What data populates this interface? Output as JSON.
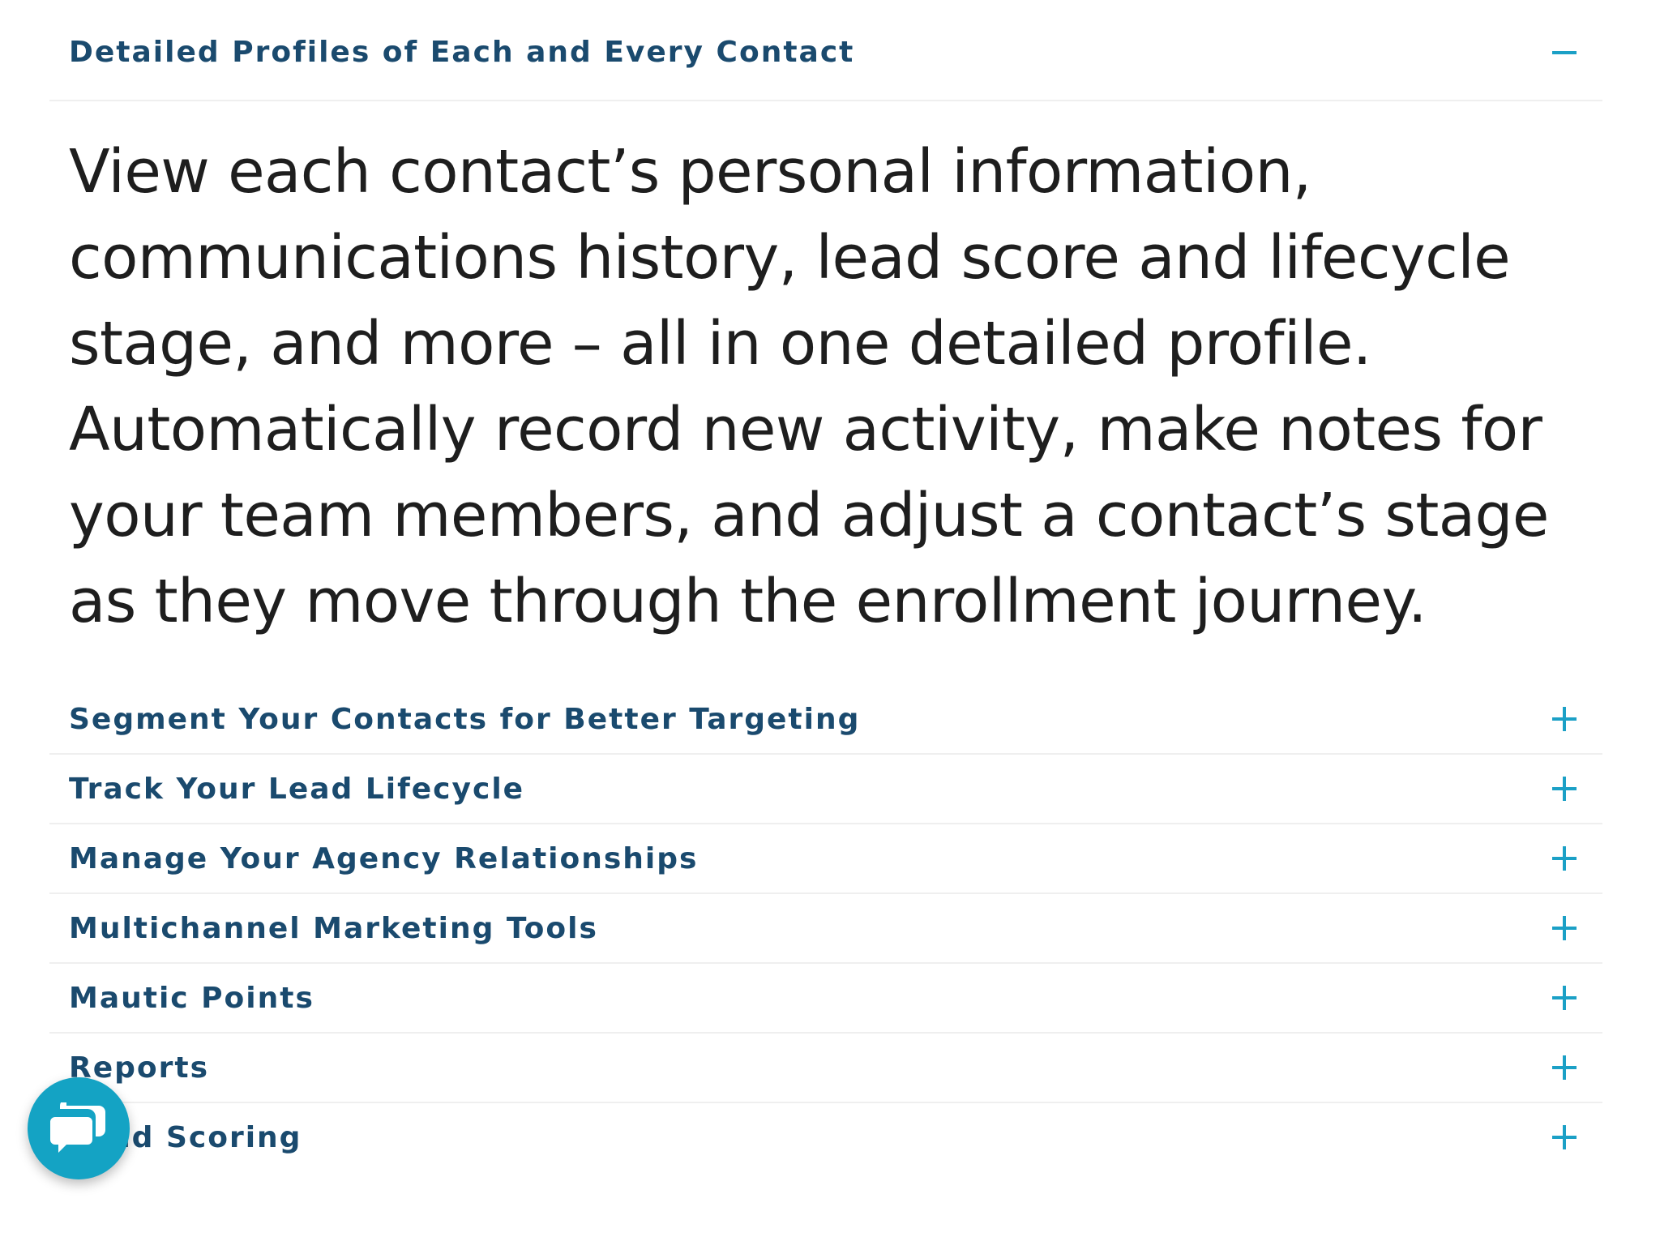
{
  "accordion": {
    "expanded": {
      "title": "Detailed Profiles of Each and Every Contact",
      "toggle_icon": "minus-icon",
      "body": "View each contact’s personal information, communications history, lead score and lifecycle stage, and more – all in one detailed profile. Automatically record new activity, make notes for your team members, and adjust a contact’s stage as they move through the enrollment journey."
    },
    "collapsed": [
      {
        "title": "Segment Your Contacts for Better Targeting",
        "toggle_icon": "plus-icon"
      },
      {
        "title": "Track Your Lead Lifecycle",
        "toggle_icon": "plus-icon"
      },
      {
        "title": "Manage Your Agency Relationships",
        "toggle_icon": "plus-icon"
      },
      {
        "title": "Multichannel Marketing Tools",
        "toggle_icon": "plus-icon"
      },
      {
        "title": "Mautic Points",
        "toggle_icon": "plus-icon"
      },
      {
        "title": "Reports",
        "toggle_icon": "plus-icon"
      },
      {
        "title": "Lead Scoring",
        "toggle_icon": "plus-icon"
      }
    ]
  },
  "chat_widget": {
    "icon": "chat-bubble-icon"
  },
  "colors": {
    "heading": "#1a4a6e",
    "toggle_accent": "#1ba0c6",
    "body_text": "#1e1e1e",
    "divider": "#efefef",
    "chat_button": "#14a3c4"
  }
}
